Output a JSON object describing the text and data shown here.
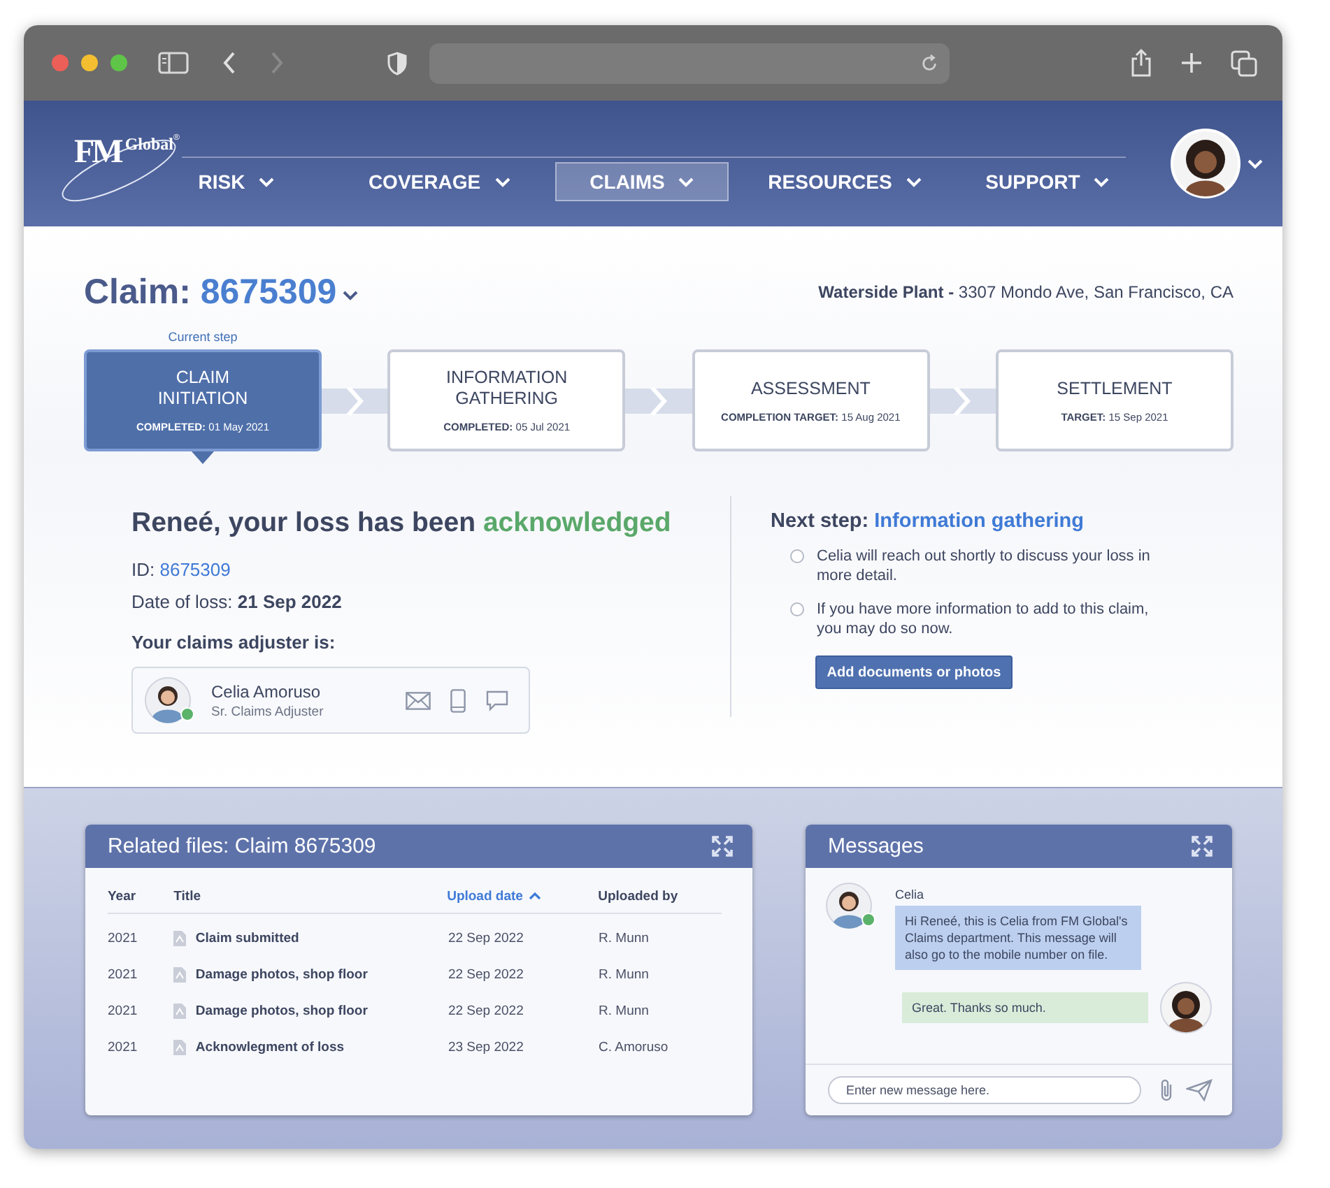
{
  "logo": {
    "main": "FM",
    "sub": "Global",
    "mark": "®"
  },
  "nav": [
    {
      "label": "RISK",
      "selected": false
    },
    {
      "label": "COVERAGE",
      "selected": false
    },
    {
      "label": "CLAIMS",
      "selected": true
    },
    {
      "label": "RESOURCES",
      "selected": false
    },
    {
      "label": "SUPPORT",
      "selected": false
    }
  ],
  "claim": {
    "label": "Claim:",
    "number": "8675309"
  },
  "location": "**Waterside Plant -** 3307 Mondo Ave, San Francisco, CA",
  "current_step_label": "Current step",
  "steps": [
    {
      "title": "CLAIM\nINITIATION",
      "date": "**COMPLETED:** 01 May 2021",
      "selected": true
    },
    {
      "title": "INFORMATION\nGATHERING",
      "date": "**COMPLETED:** 05 Jul 2021",
      "selected": false
    },
    {
      "title": "ASSESSMENT",
      "date": "**COMPLETION TARGET:** 15 Aug 2021",
      "selected": false
    },
    {
      "title": "SETTLEMENT",
      "date": "**TARGET:** 15 Sep 2021",
      "selected": false
    }
  ],
  "headline": {
    "text": "Reneé, your loss has been",
    "status": "acknowledged"
  },
  "id": {
    "label": "ID:",
    "value": "8675309"
  },
  "date_of_loss": "Date of loss: **21 Sep 2022**",
  "adjuster_heading": "Your claims adjuster is:",
  "adjuster": {
    "name": "Celia Amoruso",
    "role": "Sr. Claims Adjuster",
    "online": true
  },
  "next_step": {
    "label": "Next step:",
    "value": "Information gathering",
    "items": [
      {
        "text": "Celia will reach out shortly to discuss your loss in more detail.",
        "checked": false
      },
      {
        "text": "If you have more information to add to this claim, you may do so now.",
        "checked": false
      }
    ],
    "button": "Add documents or photos"
  },
  "files": {
    "title": "Related files: Claim 8675309",
    "columns": [
      {
        "label": "Year",
        "sorted": false
      },
      {
        "label": "Title",
        "sorted": false
      },
      {
        "label": "Upload date",
        "sorted": true
      },
      {
        "label": "Uploaded by",
        "sorted": false
      }
    ],
    "rows": [
      {
        "year": "2021",
        "title": "Claim submitted",
        "date": "22 Sep 2022",
        "by": "R. Munn"
      },
      {
        "year": "2021",
        "title": "Damage photos, shop floor",
        "date": "22 Sep 2022",
        "by": "R. Munn"
      },
      {
        "year": "2021",
        "title": "Damage photos, shop floor",
        "date": "22 Sep 2022",
        "by": "R. Munn"
      },
      {
        "year": "2021",
        "title": "Acknowlegment of loss",
        "date": "23 Sep 2022",
        "by": "C. Amoruso"
      }
    ]
  },
  "messages": {
    "title": "Messages",
    "items": [
      {
        "kind": "incoming",
        "sender": "Celia",
        "text": "Hi Reneé, this is Celia from FM Global's Claims department. This message will also go to the mobile number on file.",
        "online": true
      },
      {
        "kind": "outgoing",
        "text": "Great. Thanks so much."
      }
    ],
    "placeholder": "Enter new message here."
  }
}
